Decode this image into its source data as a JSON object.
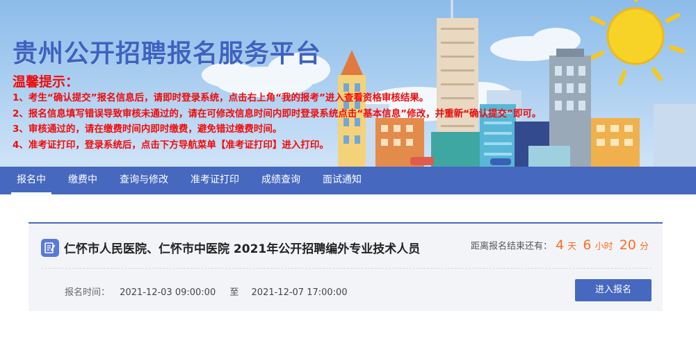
{
  "banner": {
    "site_title": "贵州公开招聘报名服务平台",
    "notice_title": "温馨提示：",
    "notices": [
      "1、考生“确认提交”报名信息后，请即时登录系统，点击右上角“我的报考”进入查看资格审核结果。",
      "2、报名信息填写错误导致审核未通过的，请在可修改信息时间内即时登录系统点击“基本信息”修改，并重新“确认提交”即可。",
      "3、审核通过的，请在缴费时间内即时缴费，避免错过缴费时间。",
      "4、准考证打印，登录系统后，点击下方导航菜单【准考证打印】进入打印。"
    ]
  },
  "nav": {
    "items": [
      {
        "label": "报名中",
        "active": true
      },
      {
        "label": "缴费中"
      },
      {
        "label": "查询与修改"
      },
      {
        "label": "准考证打印"
      },
      {
        "label": "成绩查询"
      },
      {
        "label": "面试通知"
      }
    ]
  },
  "card": {
    "icon": "edit-document-icon",
    "title": "仁怀市人民医院、仁怀市中医院 2021年公开招聘编外专业技术人员",
    "countdown": {
      "label": "距离报名结束还有：",
      "days": "4",
      "days_unit": "天",
      "hours": "6",
      "hours_unit": "小时",
      "minutes": "20",
      "minutes_unit": "分"
    },
    "time_label": "报名时间：",
    "start": "2021-12-03 09:00:00",
    "separator": "至",
    "end": "2021-12-07 17:00:00",
    "button": "进入报名"
  },
  "colors": {
    "primary": "#4668bf",
    "notice_red": "#ee0c0c",
    "countdown_orange": "#ff6c1f",
    "title_blue": "#3f62c0"
  }
}
